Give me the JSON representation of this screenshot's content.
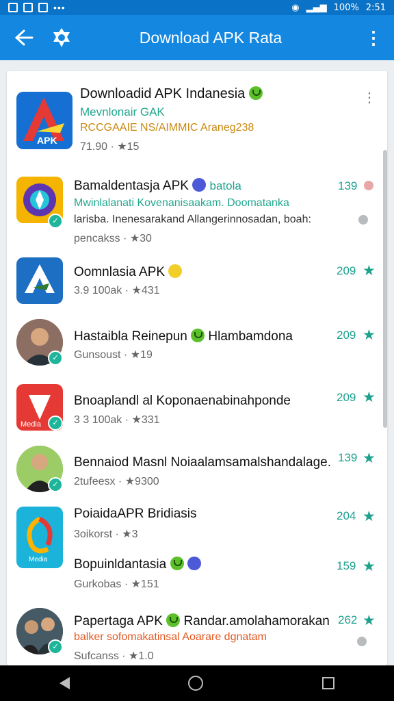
{
  "status_bar": {
    "signal": "100%",
    "time": "2:51"
  },
  "app_bar": {
    "title": "Download APK Rata"
  },
  "items": [
    {
      "name": "Downloadid APK Indanesia",
      "sub1": "Mevnlonair GAK",
      "sub2": "RCCGAAIE NS/AIMMIC Araneg238",
      "meta": "71.90 · ★15",
      "count": ""
    },
    {
      "name": "Bamaldentasja APK",
      "tag": "batola",
      "sub1": "Mwinlalanati Kovenanisaakam. Doomatanka",
      "sub2": "larisba. Inenesarakand Allangerinnosadan, boah:",
      "meta": "pencakss · ★30",
      "count": "139"
    },
    {
      "name": "Oomnlasia APK",
      "meta": "3.9 100ak · ★431",
      "count": "209"
    },
    {
      "name": "Hastaibla Reinepun",
      "name2": "Hlambamdona",
      "meta": "Gunsoust · ★19",
      "count": "209"
    },
    {
      "name": "Bnoaplandl al Koponaenabinahponde",
      "meta": "3 3 100ak · ★331",
      "count": "209"
    },
    {
      "name": "Bennaiod Masnl Noiaalamsamalshandalage.",
      "meta": "2tufeesx · ★9300",
      "count": "139"
    },
    {
      "name": "PoiaidaAPR Bridiasis",
      "meta": "3oikorst · ★3",
      "count": "204"
    },
    {
      "name": "Bopuinldantasia",
      "meta": "Gurkobas · ★151",
      "count": "159"
    },
    {
      "name": "Papertaga APK",
      "name2": "Randar.amolahamorakan",
      "sub1": "balker sofomakatinsal Aoarare dgnatam",
      "meta": "Sufcanss · ★1.0",
      "count": "262"
    }
  ]
}
